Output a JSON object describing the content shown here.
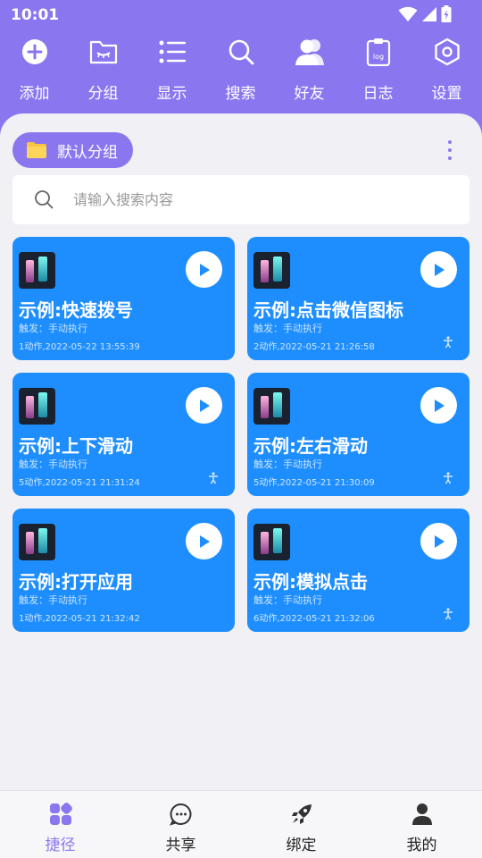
{
  "status_bar": {
    "time": "10:01"
  },
  "toolbar": [
    {
      "icon": "add-icon",
      "label": "添加"
    },
    {
      "icon": "folder-icon",
      "label": "分组"
    },
    {
      "icon": "list-icon",
      "label": "显示"
    },
    {
      "icon": "search-icon",
      "label": "搜索"
    },
    {
      "icon": "friends-icon",
      "label": "好友"
    },
    {
      "icon": "log-icon",
      "label": "日志",
      "icon_text": "log"
    },
    {
      "icon": "settings-icon",
      "label": "设置"
    }
  ],
  "group": {
    "label": "默认分组"
  },
  "search": {
    "placeholder": "请输入搜索内容"
  },
  "cards": [
    {
      "title": "示例:快速拨号",
      "trigger": "触发：手动执行",
      "meta": "1动作,2022-05-22 13:55:39",
      "person_icon": false
    },
    {
      "title": "示例:点击微信图标",
      "trigger": "触发：手动执行",
      "meta": "2动作,2022-05-21 21:26:58",
      "person_icon": true
    },
    {
      "title": "示例:上下滑动",
      "trigger": "触发：手动执行",
      "meta": "5动作,2022-05-21 21:31:24",
      "person_icon": true
    },
    {
      "title": "示例:左右滑动",
      "trigger": "触发：手动执行",
      "meta": "5动作,2022-05-21 21:30:09",
      "person_icon": true
    },
    {
      "title": "示例:打开应用",
      "trigger": "触发：手动执行",
      "meta": "1动作,2022-05-21 21:32:42",
      "person_icon": false
    },
    {
      "title": "示例:模拟点击",
      "trigger": "触发：手动执行",
      "meta": "6动作,2022-05-21 21:32:06",
      "person_icon": true
    }
  ],
  "bottom_nav": [
    {
      "icon": "shortcut-icon",
      "label": "捷径",
      "active": true
    },
    {
      "icon": "chat-icon",
      "label": "共享",
      "active": false
    },
    {
      "icon": "rocket-icon",
      "label": "绑定",
      "active": false
    },
    {
      "icon": "user-icon",
      "label": "我的",
      "active": false
    }
  ],
  "colors": {
    "accent": "#8a77f0",
    "card": "#1e8eff",
    "background": "#f1f0f5"
  }
}
